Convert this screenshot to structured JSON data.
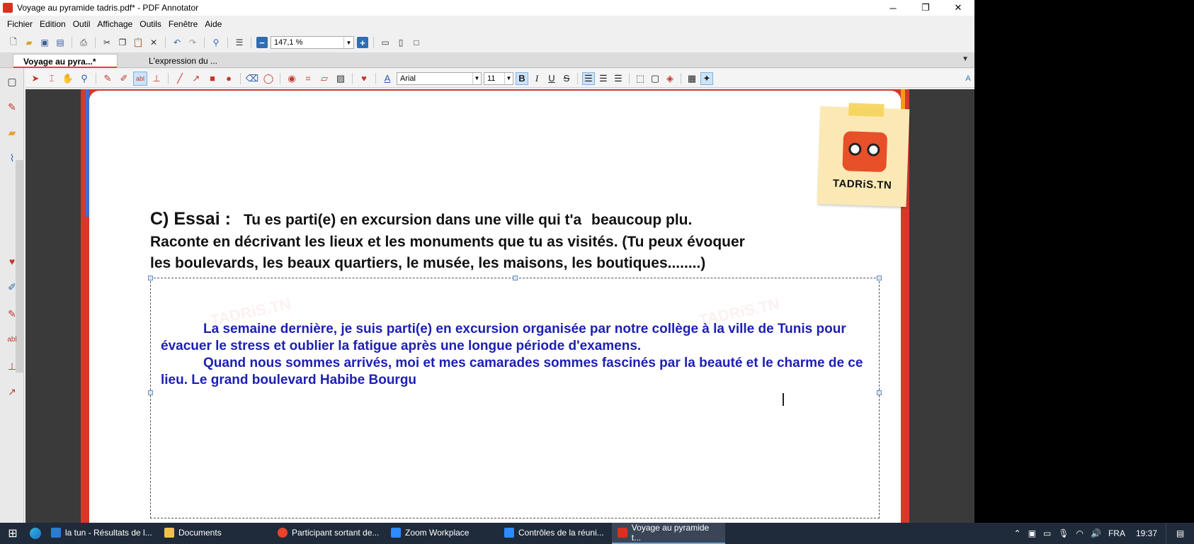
{
  "window": {
    "title": "Voyage au pyramide tadris.pdf* - PDF Annotator",
    "minimize": "─",
    "maximize": "❐",
    "close": "✕"
  },
  "menu": [
    "Fichier",
    "Edition",
    "Outil",
    "Affichage",
    "Outils",
    "Fenêtre",
    "Aide"
  ],
  "toolbar": {
    "zoom_value": "147,1 %"
  },
  "tabs": [
    {
      "label": "Voyage au pyra...*",
      "active": true
    },
    {
      "label": "L'expression du ...",
      "active": false
    }
  ],
  "annotation_toolbar": {
    "font_name": "Arial",
    "font_size": "11",
    "bold": "B",
    "italic": "I",
    "underline": "U",
    "strike": "S"
  },
  "document": {
    "logo_text": "TADRiS.TN",
    "question_label": "C) Essai :",
    "question_line1": "Tu es parti(e) en excursion dans une ville qui t'a",
    "question_ghost": "",
    "question_line1_end": "beaucoup plu.",
    "question_line2": "Raconte en décrivant les lieux et les monuments que tu as visités. (Tu peux évoquer",
    "question_line3": "les boulevards, les beaux quartiers, le musée, les maisons, les boutiques........)",
    "answer_para1": "La semaine dernière, je suis parti(e) en excursion organisée par notre collège à la ville de Tunis pour évacuer le stress et oublier la fatigue après une longue période d'examens.",
    "answer_para2": "Quand nous sommes arrivés, moi et mes camarades sommes fascinés par la beauté et le charme de ce lieu. Le grand boulevard Habibe Bourgu",
    "watermark": "TADRiS.TN"
  },
  "taskbar": {
    "tasks": [
      {
        "label": "la tun - Résultats de l...",
        "color": "#2b7bd6"
      },
      {
        "label": "Documents",
        "color": "#f0c14b"
      },
      {
        "label": "Participant sortant de...",
        "color": "#e8452c"
      },
      {
        "label": "Zoom Workplace",
        "color": "#2d8cff"
      },
      {
        "label": "Contrôles de la réuni...",
        "color": "#2d8cff"
      },
      {
        "label": "Voyage au pyramide t...",
        "color": "#d9301f"
      }
    ],
    "language": "FRA",
    "time": "19:37"
  },
  "colors": {
    "answer_text": "#1d1fb3",
    "page_border": "#d7382b",
    "accent_blue": "#3f6fd0"
  }
}
